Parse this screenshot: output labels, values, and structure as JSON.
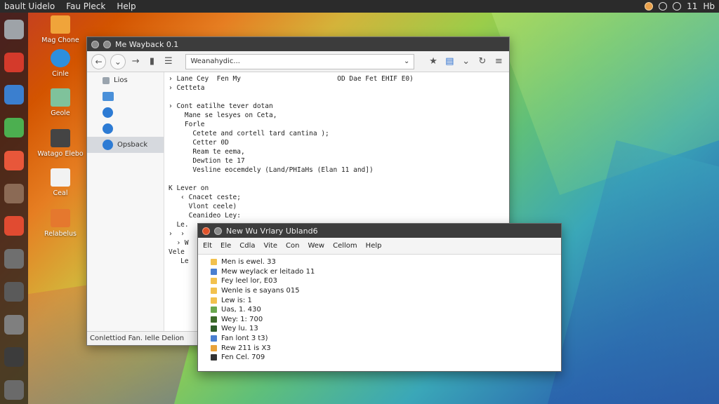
{
  "top_panel": {
    "menus": [
      "bault Uidelo",
      "Fau Pleck",
      "Help"
    ],
    "time": "11",
    "indicator": "Hb"
  },
  "launcher": {
    "items": [
      {
        "icon": "dash-home-icon",
        "color": "#9ea3a8"
      },
      {
        "icon": "music-app-icon",
        "color": "#d43a2b"
      },
      {
        "icon": "office-suite-icon",
        "color": "#3b7fcf"
      },
      {
        "icon": "color-wheel-icon",
        "color": "#4caf50"
      },
      {
        "icon": "browser-icon",
        "color": "#e8573a"
      },
      {
        "icon": "chart-app-icon",
        "color": "#8b6a55"
      },
      {
        "icon": "document-icon",
        "color": "#e14b31"
      },
      {
        "icon": "disk-utility-icon",
        "color": "#6f6f6f"
      },
      {
        "icon": "terminal-icon",
        "color": "#5a5a5a"
      },
      {
        "icon": "storage-icon",
        "color": "#7f7f7f"
      },
      {
        "icon": "network-icon",
        "color": "#3c3c3c"
      },
      {
        "icon": "trash-icon",
        "color": "#6a6a6a"
      }
    ]
  },
  "desktop_icons": [
    {
      "label": "Mag Chone",
      "color": "#f0a43a"
    },
    {
      "label": "Cinle",
      "color": "#2d8fdd"
    },
    {
      "label": "Geole",
      "color": "#7fc29b"
    },
    {
      "label": "Watago Elebo",
      "color": "#444444"
    },
    {
      "label": "Ceal",
      "color": "#f2f2f2"
    },
    {
      "label": "Relabelus",
      "color": "#e5782e"
    }
  ],
  "main_window": {
    "title": "Me Wayback 0.1",
    "address": "Weanahydic...",
    "sidebar": [
      {
        "label": "Lios",
        "kind": "drive"
      },
      {
        "label": "",
        "kind": "folder"
      },
      {
        "label": "",
        "kind": "globe"
      },
      {
        "label": "",
        "kind": "globe"
      },
      {
        "label": "Opsback",
        "kind": "active"
      }
    ],
    "lines": [
      "› Lane Cey  Fen My                        OD Dae Fet EHIF E0)",
      "› Cetteta",
      "",
      "› Cont eatilhe tever dotan",
      "    Mane se lesyes on Ceta,",
      "    Forle",
      "      Cetete and cortell tard cantina );",
      "      Cetter 0D",
      "      Ream te eema,",
      "      Dewtion te 17",
      "      Vesline eocemdely (Land/PHIaHs (Elan 11 and])",
      "",
      "K Lever on",
      "   ‹ Cnacet ceste;",
      "     Vlont ceele)",
      "     Ceanideo Ley:",
      "  Le.",
      "›  ›",
      "  › W",
      "Vele",
      "   Le"
    ],
    "status": "Conlettiod Fan. Ielle Delion"
  },
  "second_window": {
    "title": "New Wu Vrlary Ubland6",
    "menus": [
      "Elt",
      "Ele",
      "Cdla",
      "Vite",
      "Con",
      "Wew",
      "Cellom",
      "Help"
    ],
    "files": [
      {
        "name": "Men is ewel. 33",
        "color": "#f2c14e"
      },
      {
        "name": "Mew weylack er leitado 11",
        "color": "#4a7fd0"
      },
      {
        "name": "Fey leel lor, E03",
        "color": "#f2c14e"
      },
      {
        "name": "Wenle is e sayans 015",
        "color": "#f2c14e"
      },
      {
        "name": "Lew is:  1",
        "color": "#f2c14e"
      },
      {
        "name": "Uas, 1. 430",
        "color": "#6aa84f"
      },
      {
        "name": "Wey: 1: 700",
        "color": "#3d6b2a"
      },
      {
        "name": "Wey lu. 13",
        "color": "#2f5e2a"
      },
      {
        "name": "Fan lont 3 t3)",
        "color": "#4a7fd0"
      },
      {
        "name": "Rew 211 is X3",
        "color": "#e8a23a"
      },
      {
        "name": "Fen Cel. 709",
        "color": "#333333"
      }
    ]
  }
}
